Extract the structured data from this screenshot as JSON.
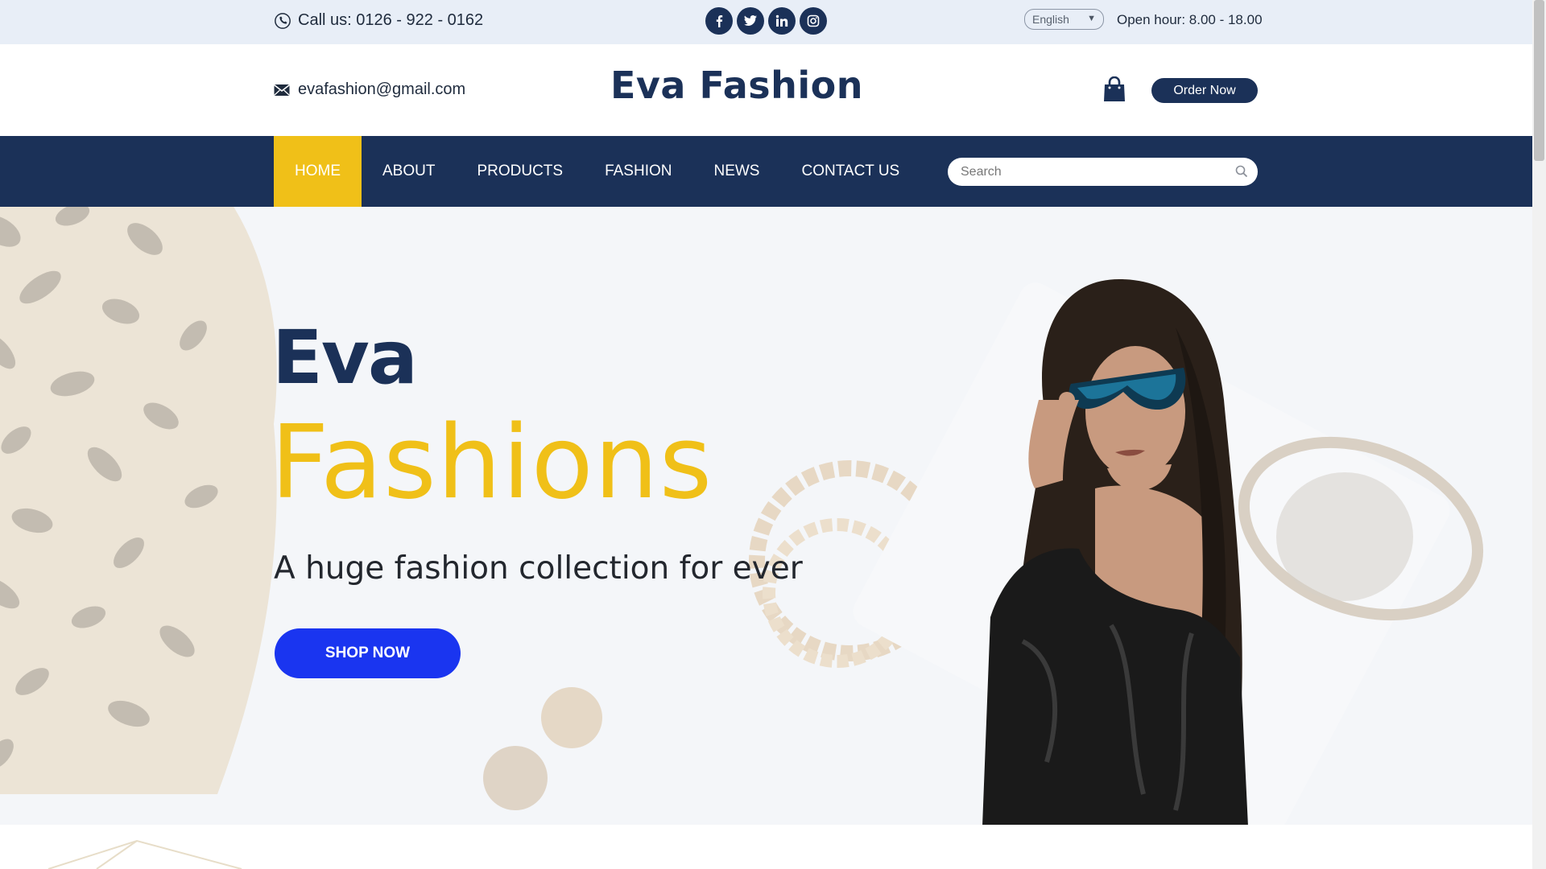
{
  "topbar": {
    "phone": "Call us: 0126 - 922 - 0162",
    "socials": [
      "facebook-icon",
      "twitter-icon",
      "linkedin-icon",
      "instagram-icon"
    ],
    "language": "English",
    "hours": "Open hour: 8.00 - 18.00"
  },
  "header": {
    "email": "evafashion@gmail.com",
    "logo": "Eva Fashion",
    "order_label": "Order Now"
  },
  "nav": {
    "items": [
      {
        "label": "HOME"
      },
      {
        "label": "ABOUT"
      },
      {
        "label": "PRODUCTS"
      },
      {
        "label": "FASHION"
      },
      {
        "label": "NEWS"
      },
      {
        "label": "CONTACT US"
      }
    ],
    "active_index": 0,
    "search_placeholder": "Search"
  },
  "hero": {
    "title_line1": "Eva",
    "title_line2": "Fashions",
    "subtitle": "A huge fashion collection for ever",
    "button_label": "SHOP NOW"
  },
  "colors": {
    "navy": "#1b3158",
    "yellow": "#f0c018",
    "cta_blue": "#1a35f0",
    "topbar_bg": "#e8eef7"
  }
}
